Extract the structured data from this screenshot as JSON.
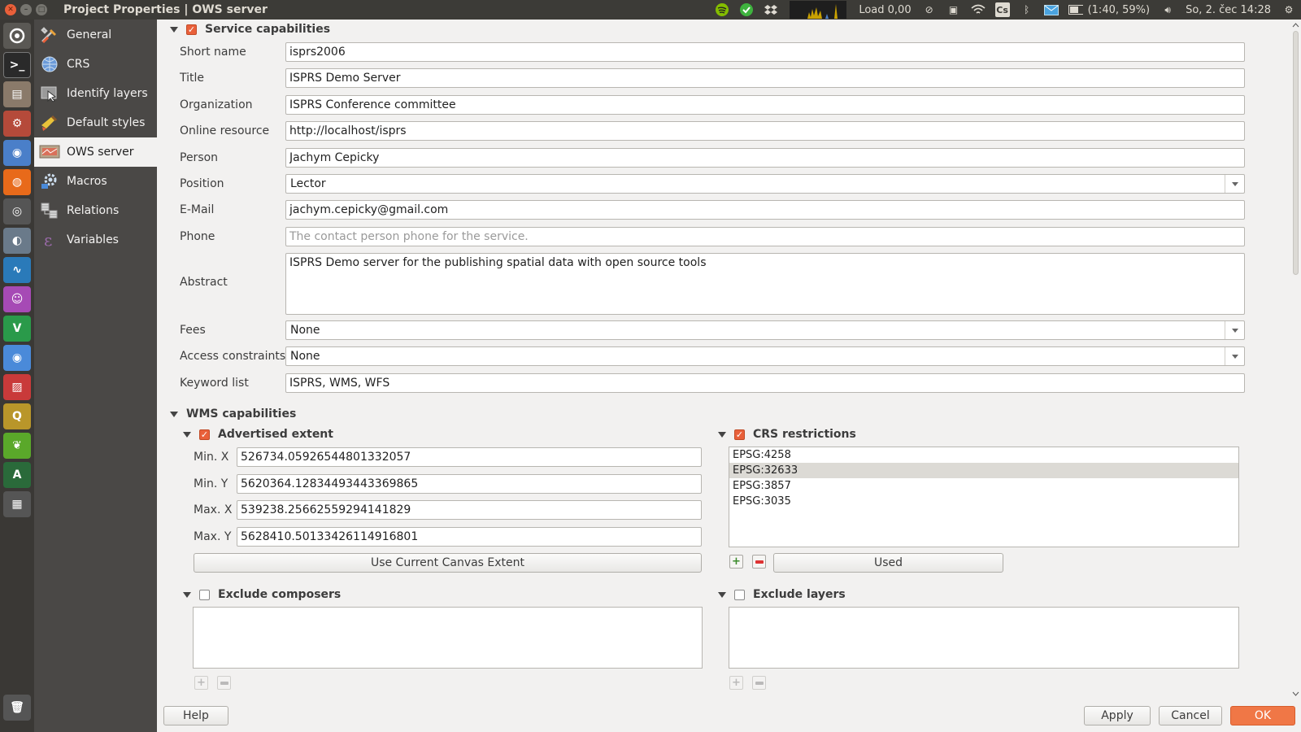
{
  "window": {
    "title": "Project Properties | OWS server"
  },
  "tray": {
    "load": "Load 0,00",
    "battery": "(1:40, 59%)",
    "clock": "So, 2. čec 14:28",
    "keyboard": "Cs"
  },
  "nav": [
    {
      "label": "General",
      "icon": "general-icon"
    },
    {
      "label": "CRS",
      "icon": "globe-icon"
    },
    {
      "label": "Identify layers",
      "icon": "identify-icon"
    },
    {
      "label": "Default styles",
      "icon": "styles-icon"
    },
    {
      "label": "OWS server",
      "icon": "ows-icon",
      "selected": true
    },
    {
      "label": "Macros",
      "icon": "macros-icon"
    },
    {
      "label": "Relations",
      "icon": "relations-icon"
    },
    {
      "label": "Variables",
      "icon": "variables-icon"
    }
  ],
  "service": {
    "header": "Service capabilities",
    "enabled": true,
    "short_name": {
      "label": "Short name",
      "value": "isprs2006"
    },
    "title": {
      "label": "Title",
      "value": "ISPRS Demo Server"
    },
    "organization": {
      "label": "Organization",
      "value": "ISPRS Conference committee"
    },
    "online_resource": {
      "label": "Online resource",
      "value": "http://localhost/isprs"
    },
    "person": {
      "label": "Person",
      "value": "Jachym Cepicky"
    },
    "position": {
      "label": "Position",
      "value": "Lector"
    },
    "email": {
      "label": "E-Mail",
      "value": "jachym.cepicky@gmail.com"
    },
    "phone": {
      "label": "Phone",
      "value": "",
      "placeholder": "The contact person phone for the service."
    },
    "abstract": {
      "label": "Abstract",
      "value": "ISPRS Demo server for the publishing spatial data with open source tools"
    },
    "fees": {
      "label": "Fees",
      "value": "None"
    },
    "access": {
      "label": "Access constraints",
      "value": "None"
    },
    "keywords": {
      "label": "Keyword list",
      "value": "ISPRS, WMS, WFS"
    }
  },
  "wms": {
    "header": "WMS capabilities",
    "extent": {
      "header": "Advertised extent",
      "enabled": true,
      "minx": {
        "label": "Min. X",
        "value": "526734.05926544801332057"
      },
      "miny": {
        "label": "Min. Y",
        "value": "5620364.12834493443369865"
      },
      "maxx": {
        "label": "Max. X",
        "value": "539238.25662559294141829"
      },
      "maxy": {
        "label": "Max. Y",
        "value": "5628410.50133426114916801"
      },
      "canvas_button": "Use Current Canvas Extent"
    },
    "crs": {
      "header": "CRS restrictions",
      "enabled": true,
      "items": [
        "EPSG:4258",
        "EPSG:32633",
        "EPSG:3857",
        "EPSG:3035"
      ],
      "selected_index": 1,
      "used_button": "Used"
    },
    "composers": {
      "header": "Exclude composers",
      "enabled": false
    },
    "layers": {
      "header": "Exclude layers",
      "enabled": false
    }
  },
  "buttons": {
    "help": "Help",
    "apply": "Apply",
    "cancel": "Cancel",
    "ok": "OK"
  },
  "colors": {
    "accent": "#e9603a",
    "ok_button": "#f07746",
    "sidebar": "#4a4846",
    "topbar": "#3c3b37"
  }
}
